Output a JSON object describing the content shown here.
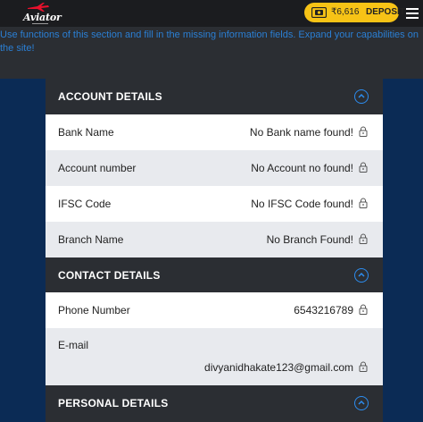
{
  "header": {
    "logo_text": "Aviator",
    "balance": "₹6,616",
    "deposit_label": "DEPOSIT",
    "wallet_icon": "wallet-icon",
    "menu_icon": "hamburger-icon",
    "accent_color": "#f7c316"
  },
  "info": {
    "text": "Use functions of this section and fill in the missing information fields. Expand your capabilities on the site!"
  },
  "sections": {
    "account": {
      "title": "ACCOUNT DETAILS",
      "rows": [
        {
          "label": "Bank Name",
          "value": "No Bank name found!"
        },
        {
          "label": "Account number",
          "value": "No Account no found!"
        },
        {
          "label": "IFSC Code",
          "value": "No IFSC Code found!"
        },
        {
          "label": "Branch Name",
          "value": "No Branch Found!"
        }
      ]
    },
    "contact": {
      "title": "CONTACT DETAILS",
      "rows": [
        {
          "label": "Phone Number",
          "value": "6543216789"
        },
        {
          "label": "E-mail",
          "value": "divyanidhakate123@gmail.com"
        }
      ]
    },
    "personal": {
      "title": "PERSONAL DETAILS"
    }
  },
  "colors": {
    "section_header": "#2b2e33",
    "page_background": "#0b2b55",
    "chevron": "#2c8df0",
    "info_link": "#2b7fd4"
  }
}
